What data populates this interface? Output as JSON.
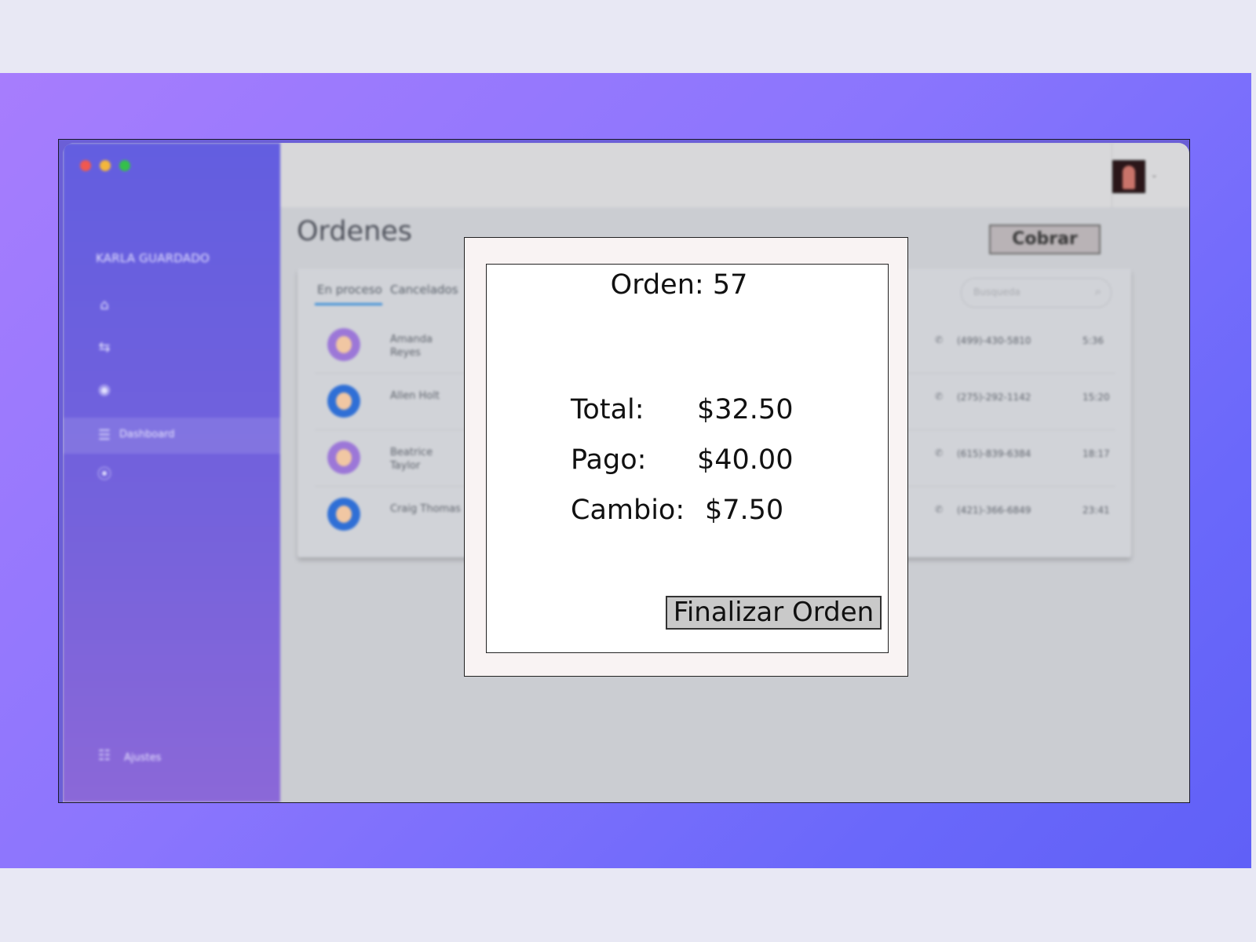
{
  "app": {
    "user_name": "KARLA GUARDADO",
    "nav_active_label": "Dashboard",
    "settings_label": "Ajustes",
    "page_title": "Ordenes",
    "collect_button": "Cobrar"
  },
  "tabs": [
    {
      "label": "En proceso",
      "active": true
    },
    {
      "label": "Cancelados",
      "active": false
    }
  ],
  "search": {
    "placeholder": "Busqueda"
  },
  "orders": [
    {
      "name": "Amanda Reyes",
      "phone": "(499)-430-5810",
      "time": "5:36",
      "avatar": "female-avatar"
    },
    {
      "name": "Allen Holt",
      "phone": "(275)-292-1142",
      "time": "15:20",
      "avatar": "male-avatar"
    },
    {
      "name": "Beatrice Taylor",
      "phone": "(615)-839-6384",
      "time": "18:17",
      "avatar": "female-avatar"
    },
    {
      "name": "Craig Thomas",
      "phone": "(421)-366-6849",
      "time": "23:41",
      "avatar": "male-avatar"
    }
  ],
  "modal": {
    "order_title": "Orden: 57",
    "total_label": "Total:",
    "total_value": "$32.50",
    "payment_label": "Pago:",
    "payment_value": "$40.00",
    "change_label": "Cambio:",
    "change_value": "$7.50",
    "finish_button": "Finalizar Orden"
  },
  "colors": {
    "background_gradient_start": "#a77dfd",
    "background_gradient_end": "#6060f7",
    "sidebar": "#635ee0",
    "tab_accent": "#3f8fd8",
    "modal_border": "#222222"
  }
}
